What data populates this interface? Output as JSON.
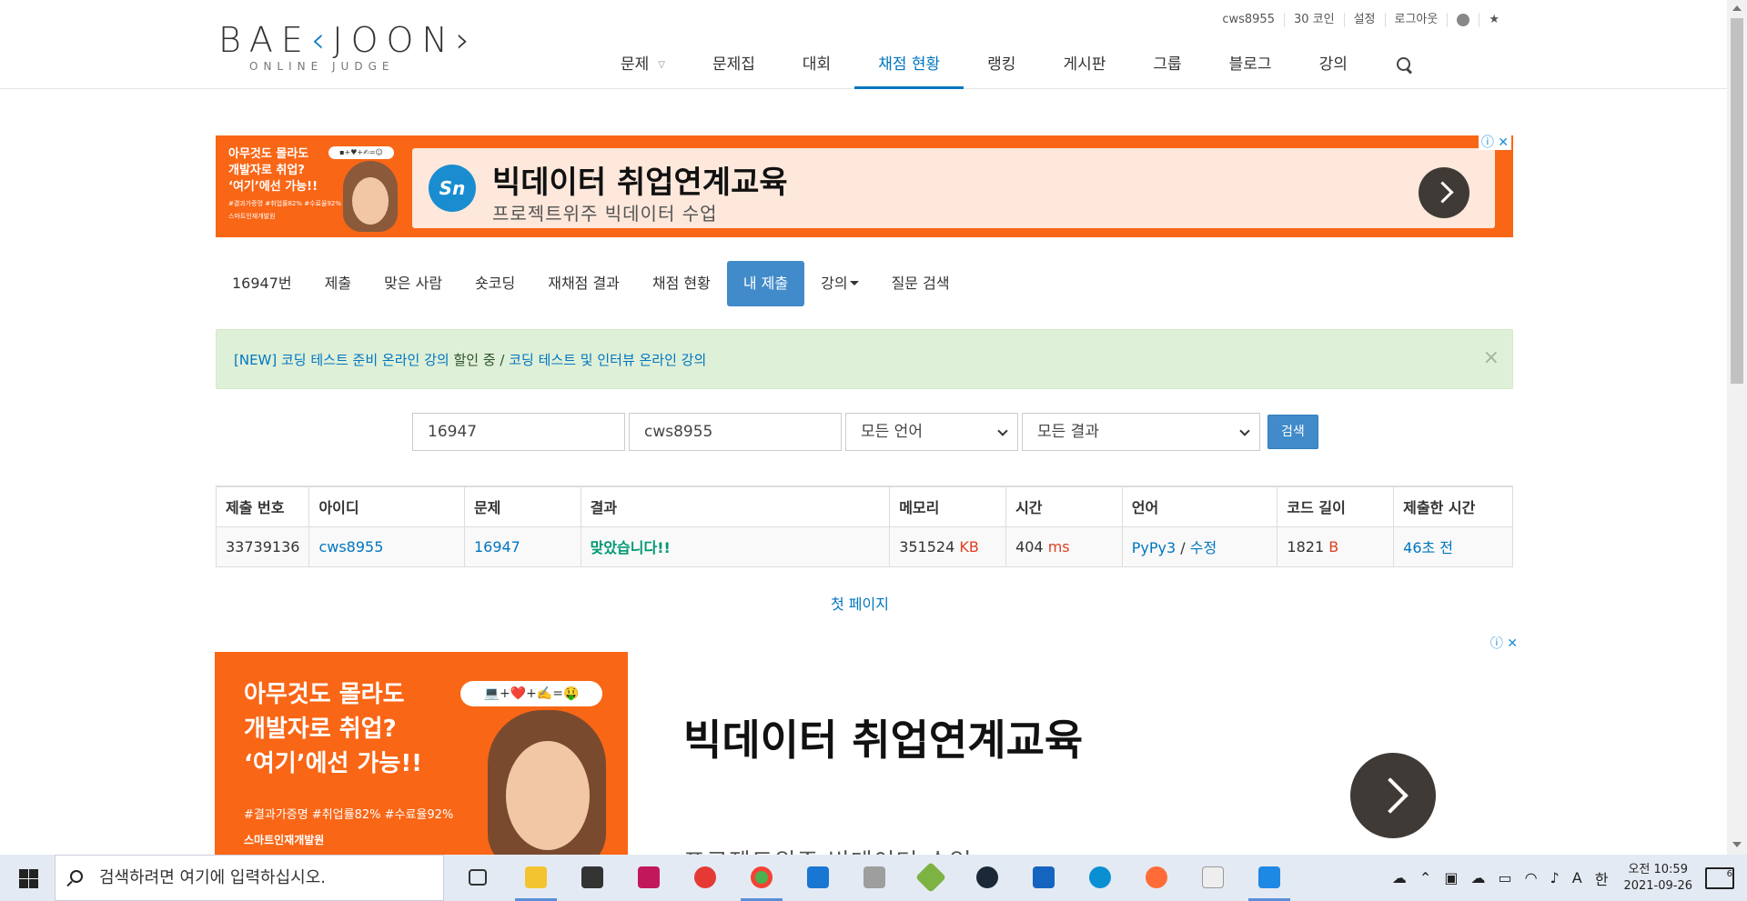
{
  "logo": {
    "main_left": "BAE",
    "main_mid": "‹",
    "main_right": "JOON›",
    "sub": "ONLINE JUDGE"
  },
  "topbar": {
    "user": "cws8955",
    "coins": "30 코인",
    "settings": "설정",
    "logout": "로그아웃"
  },
  "nav": {
    "items": [
      {
        "label": "문제"
      },
      {
        "label": "문제집"
      },
      {
        "label": "대회"
      },
      {
        "label": "채점 현황"
      },
      {
        "label": "랭킹"
      },
      {
        "label": "게시판"
      },
      {
        "label": "그룹"
      },
      {
        "label": "블로그"
      },
      {
        "label": "강의"
      }
    ]
  },
  "ad1": {
    "left_text_1": "아무것도 몰라도",
    "left_text_2": "개발자로 취업?",
    "left_text_3": "‘여기’에선 가능!!",
    "tags": "#결과가증명 #취업률82% #수료율92%",
    "brand": "스마트인재개발원",
    "logo_text": "Sn",
    "title": "빅데이터 취업연계교육",
    "subtitle": "프로젝트위주 빅데이터 수업"
  },
  "subnav": {
    "items": [
      {
        "label": "16947번"
      },
      {
        "label": "제출"
      },
      {
        "label": "맞은 사람"
      },
      {
        "label": "숏코딩"
      },
      {
        "label": "재채점 결과"
      },
      {
        "label": "채점 현황"
      },
      {
        "label": "내 제출"
      },
      {
        "label": "강의"
      },
      {
        "label": "질문 검색"
      }
    ]
  },
  "alert": {
    "prefix": "[NEW] 코딩 테스트 준비 온라인 강의",
    "highlight": "할인 중",
    "separator": " / ",
    "suffix": "코딩 테스트 및 인터뷰 온라인 강의",
    "close": "×"
  },
  "search": {
    "problem_id": "16947",
    "user_id": "cws8955",
    "language": "모든 언어",
    "result": "모든 결과",
    "button": "검색"
  },
  "table": {
    "headers": [
      "제출 번호",
      "아이디",
      "문제",
      "결과",
      "메모리",
      "시간",
      "언어",
      "코드 길이",
      "제출한 시간"
    ],
    "rows": [
      {
        "submission_id": "33739136",
        "user": "cws8955",
        "problem": "16947",
        "result": "맞았습니다!!",
        "memory": "351524",
        "memory_unit": "KB",
        "time": "404",
        "time_unit": "ms",
        "language": "PyPy3",
        "lang_sep": " / ",
        "edit": "수정",
        "code_length": "1821",
        "code_unit": "B",
        "submitted": "46초 전"
      }
    ]
  },
  "pagination": {
    "first": "첫 페이지"
  },
  "ad2": {
    "line1": "아무것도 몰라도",
    "line2": "개발자로 취업?",
    "line3": "‘여기’에선 가능!!",
    "emoji": "💻+❤️+✍️=🤑",
    "tags": "#결과가증명  #취업률82%  #수료율92%",
    "brand": "스마트인재개발원",
    "title": "빅데이터 취업연계교육",
    "subtitle": "프로젝트위주 빅데이터 수업"
  },
  "taskbar": {
    "search_placeholder": "검색하려면 여기에 입력하십시오.",
    "time": "오전 10:59",
    "date": "2021-09-26",
    "ime_a": "A",
    "ime_lang": "한",
    "notif_count": "6"
  },
  "colors": {
    "accent": "#0076c0",
    "active_tab": "#428bca",
    "ad_orange": "#f96616",
    "ok_green": "#009874",
    "unit_red": "#dd4124"
  }
}
